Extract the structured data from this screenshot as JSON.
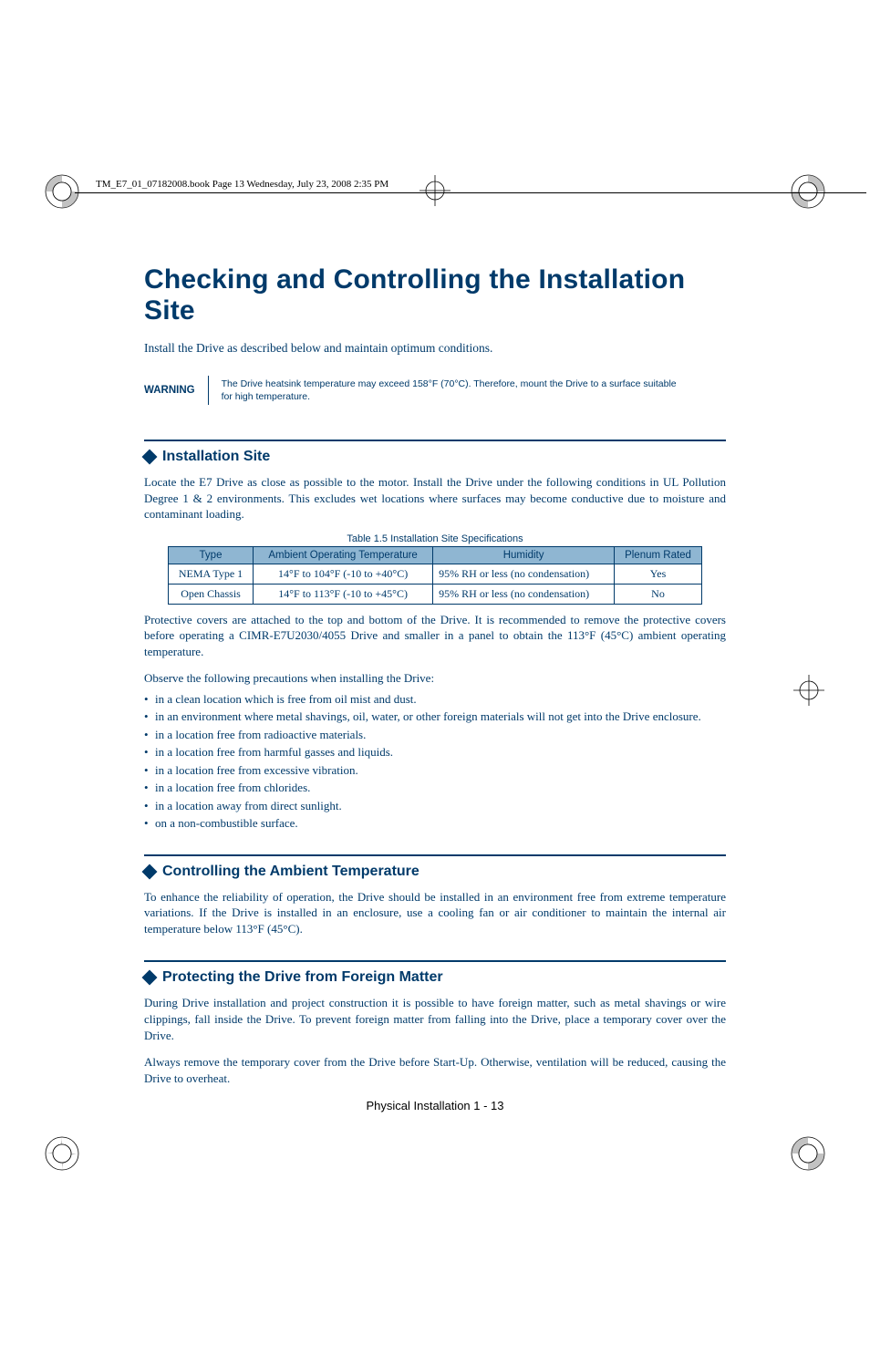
{
  "bookinfo": "TM_E7_01_07182008.book  Page 13  Wednesday, July 23, 2008  2:35 PM",
  "title": "Checking and Controlling the Installation Site",
  "intro": "Install the Drive as described below and maintain optimum conditions.",
  "warning": {
    "label": "WARNING",
    "text": "The Drive heatsink temperature may exceed 158°F (70°C). Therefore, mount the Drive to a surface suitable for high temperature."
  },
  "sections": {
    "installation": {
      "heading": "Installation Site",
      "p1": "Locate the E7 Drive as close as possible to the motor. Install the Drive under the following conditions in UL Pollution Degree 1 & 2 environments. This excludes wet locations where surfaces may become conductive due to moisture and contaminant loading.",
      "table": {
        "caption": "Table 1.5  Installation Site Specifications",
        "headers": [
          "Type",
          "Ambient Operating Temperature",
          "Humidity",
          "Plenum Rated"
        ],
        "rows": [
          [
            "NEMA Type 1",
            "14°F to 104°F (-10 to +40°C)",
            "95% RH or less (no condensation)",
            "Yes"
          ],
          [
            "Open Chassis",
            "14°F to 113°F (-10 to +45°C)",
            "95% RH or less (no condensation)",
            "No"
          ]
        ]
      },
      "p2": "Protective covers are attached to the top and bottom of the Drive. It is recommended to remove the protective covers before operating a CIMR-E7U2030/4055 Drive and smaller in a panel to obtain the 113°F (45°C) ambient operating temperature.",
      "p3": "Observe the following precautions when installing the Drive:",
      "bullets": [
        "in a clean location which is free from oil mist and dust.",
        "in an environment where metal shavings, oil, water, or other foreign materials will not get into the Drive enclosure.",
        "in a location free from radioactive materials.",
        "in a location free from harmful gasses and liquids.",
        "in a location free from excessive vibration.",
        "in a location free from chlorides.",
        "in a location away from direct sunlight.",
        "on a non-combustible surface."
      ]
    },
    "ambient": {
      "heading": "Controlling the Ambient Temperature",
      "p1": "To enhance the reliability of operation, the Drive should be installed in an environment free from extreme temperature variations. If the Drive is installed in an enclosure, use a cooling fan or air conditioner to maintain the internal air temperature below 113°F (45°C)."
    },
    "protect": {
      "heading": "Protecting the Drive from Foreign Matter",
      "p1": "During Drive installation and project construction it is possible to have foreign matter, such as metal shavings or wire clippings, fall inside the Drive. To prevent foreign matter from falling into the Drive, place a temporary cover over the Drive.",
      "p2": "Always remove the temporary cover from the Drive before Start-Up. Otherwise, ventilation will be reduced, causing the Drive to overheat."
    }
  },
  "footer": "Physical Installation  1 - 13"
}
